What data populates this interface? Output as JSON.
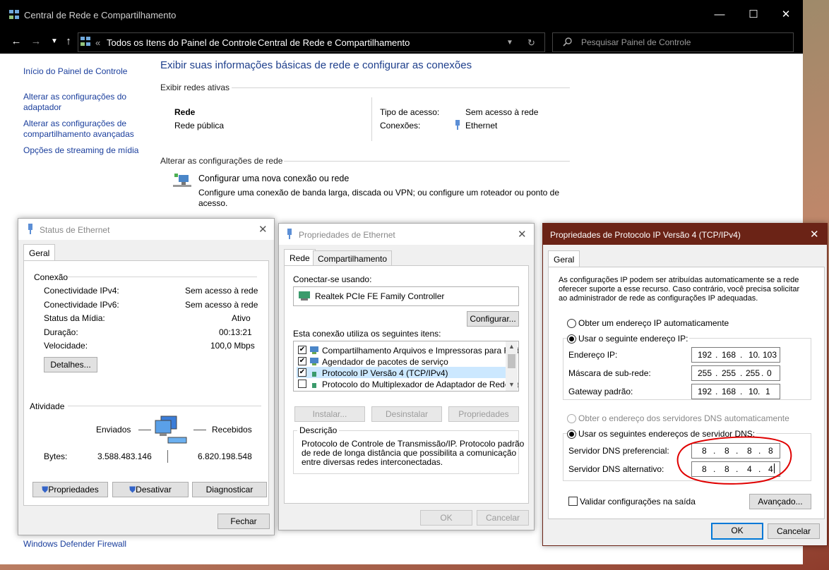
{
  "cp": {
    "title": "Central de Rede e Compartilhamento",
    "breadcrumb": [
      "Todos os Itens do Painel de Controle",
      "Central de Rede e Compartilhamento"
    ],
    "search_placeholder": "Pesquisar Painel de Controle",
    "sidebar": [
      "Início do Painel de Controle",
      "Alterar as configurações do",
      "adaptador",
      "Alterar as configurações de",
      "compartilhamento avançadas",
      "Opções de streaming de mídia"
    ],
    "see_also": "Windows Defender Firewall",
    "heading": "Exibir suas informações básicas de rede e configurar as conexões",
    "active_networks": "Exibir redes ativas",
    "net_name": "Rede",
    "net_type": "Rede pública",
    "access_label": "Tipo de acesso:",
    "access_value": "Sem acesso à rede",
    "conn_label": "Conexões:",
    "conn_value": "Ethernet",
    "change_settings": "Alterar as configurações de rede",
    "new_conn_link": "Configurar uma nova conexão ou rede",
    "new_conn_desc1": "Configure uma conexão de banda larga, discada ou VPN; ou configure um roteador ou ponto de",
    "new_conn_desc2": "acesso."
  },
  "status": {
    "title": "Status de Ethernet",
    "tab": "Geral",
    "conn_header": "Conexão",
    "rows": [
      {
        "k": "Conectividade IPv4:",
        "v": "Sem acesso à rede"
      },
      {
        "k": "Conectividade IPv6:",
        "v": "Sem acesso à rede"
      },
      {
        "k": "Status da Mídia:",
        "v": "Ativo"
      },
      {
        "k": "Duração:",
        "v": "00:13:21"
      },
      {
        "k": "Velocidade:",
        "v": "100,0 Mbps"
      }
    ],
    "details_btn": "Detalhes...",
    "activity_header": "Atividade",
    "sent": "Enviados",
    "received": "Recebidos",
    "bytes_label": "Bytes:",
    "bytes_sent": "3.588.483.146",
    "bytes_recv": "6.820.198.548",
    "btn_props": "Propriedades",
    "btn_disable": "Desativar",
    "btn_diag": "Diagnosticar",
    "btn_close": "Fechar"
  },
  "props": {
    "title": "Propriedades de Ethernet",
    "tab1": "Rede",
    "tab2": "Compartilhamento",
    "connect_using": "Conectar-se usando:",
    "adapter": "Realtek PCIe FE Family Controller",
    "configure_btn": "Configurar...",
    "items_label": "Esta conexão utiliza os seguintes itens:",
    "items": [
      {
        "checked": "✔",
        "label": "Compartilhamento Arquivos e Impressoras para Redes"
      },
      {
        "checked": "✔",
        "label": "Agendador de pacotes de serviço"
      },
      {
        "checked": "✔",
        "label": "Protocolo IP Versão 4 (TCP/IPv4)"
      },
      {
        "checked": "",
        "label": "Protocolo do Multiplexador de Adaptador de Rede da M"
      }
    ],
    "install_btn": "Instalar...",
    "uninstall_btn": "Desinstalar",
    "properties_btn": "Propriedades",
    "desc_header": "Descrição",
    "desc": [
      "Protocolo de Controle de Transmissão/IP. Protocolo padrão",
      "de rede de longa distância que possibilita a comunicação",
      "entre diversas redes interconectadas."
    ],
    "ok_btn": "OK",
    "cancel_btn": "Cancelar"
  },
  "ipv4": {
    "title": "Propriedades de Protocolo IP Versão 4 (TCP/IPv4)",
    "tab": "Geral",
    "intro": [
      "As configurações IP podem ser atribuídas automaticamente se a rede",
      "oferecer suporte a esse recurso. Caso contrário, você precisa solicitar",
      "ao administrador de rede as configurações IP adequadas."
    ],
    "auto_ip": "Obter um endereço IP automaticamente",
    "manual_ip": "Usar o seguinte endereço IP:",
    "ip_label": "Endereço IP:",
    "ip": [
      "192",
      "168",
      "10",
      "103"
    ],
    "mask_label": "Máscara de sub-rede:",
    "mask": [
      "255",
      "255",
      "255",
      "0"
    ],
    "gw_label": "Gateway padrão:",
    "gw": [
      "192",
      "168",
      "10",
      "1"
    ],
    "auto_dns": "Obter o endereço dos servidores DNS automaticamente",
    "manual_dns": "Usar os seguintes endereços de servidor DNS:",
    "dns1_label": "Servidor DNS preferencial:",
    "dns1": [
      "8",
      "8",
      "8",
      "8"
    ],
    "dns2_label": "Servidor DNS alternativo:",
    "dns2": [
      "8",
      "8",
      "4",
      "4"
    ],
    "validate": "Validar configurações na saída",
    "advanced_btn": "Avançado...",
    "ok_btn": "OK",
    "cancel_btn": "Cancelar"
  },
  "colors": {
    "titlebar_ipv4": "#6b2316",
    "annotation": "#e00000",
    "link": "#1a3e9c"
  }
}
